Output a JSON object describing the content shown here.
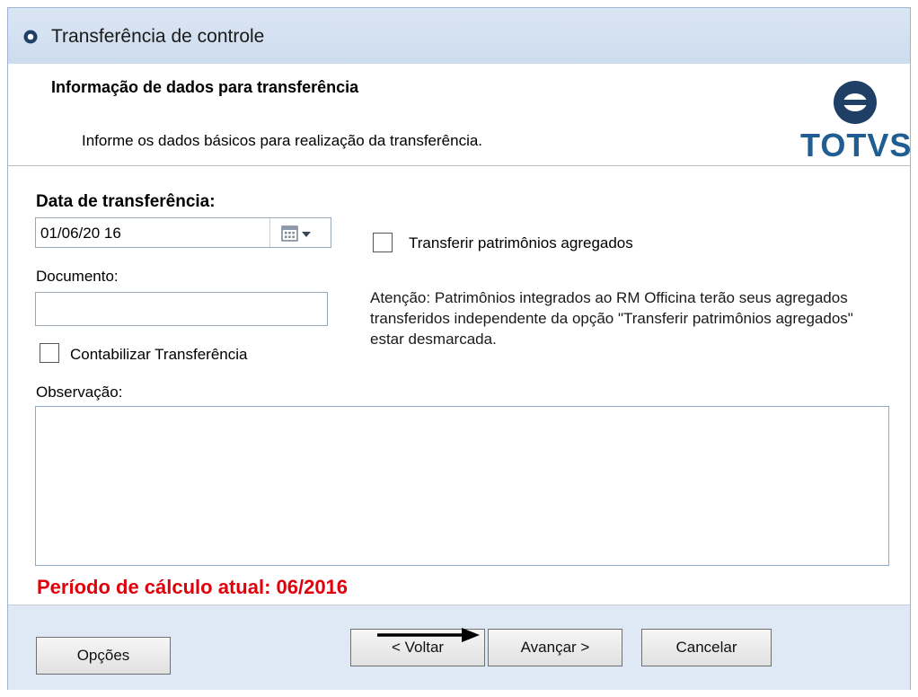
{
  "window": {
    "title": "Transferência de controle"
  },
  "header": {
    "title": "Informação de dados para transferência",
    "subtitle": "Informe os dados básicos para realização da transferência.",
    "logo_text": "TOTVS"
  },
  "form": {
    "date_label": "Data de transferência:",
    "date_value": "01/06/20 16",
    "document_label": "Documento:",
    "document_value": "",
    "contabilizar_label": "Contabilizar Transferência",
    "contabilizar_checked": false,
    "observacao_label": "Observação:",
    "observacao_value": "",
    "transferir_label": "Transferir patrimônios agregados",
    "transferir_checked": false,
    "attention_text": "Atenção: Patrimônios integrados ao RM Officina terão seus agregados transferidos independente da opção \"Transferir patrimônios agregados\" estar desmarcada.",
    "period_text": "Período de cálculo atual: 06/2016"
  },
  "footer": {
    "options_label": "Opções",
    "back_label": "< Voltar",
    "next_label": "Avançar >",
    "cancel_label": "Cancelar"
  },
  "colors": {
    "brand": "#1f5d92",
    "warning": "#e0000b",
    "window_bg": "#dfe9f6"
  }
}
